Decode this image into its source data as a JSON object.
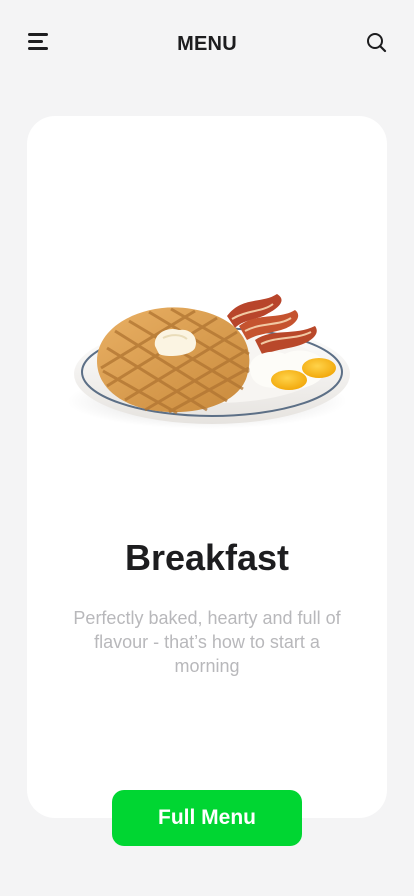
{
  "header": {
    "title": "MENU",
    "menu_icon": "hamburger-menu-icon",
    "search_icon": "search-icon"
  },
  "card": {
    "image": "breakfast-plate-image",
    "title": "Breakfast",
    "description": "Perfectly baked, hearty and full of flavour - that’s how to start a morning"
  },
  "cta": {
    "label": "Full Menu",
    "color": "#00d632"
  },
  "colors": {
    "background": "#f4f4f5",
    "card": "#ffffff",
    "text": "#1d1d1f",
    "muted_text": "#b8b8bb"
  }
}
